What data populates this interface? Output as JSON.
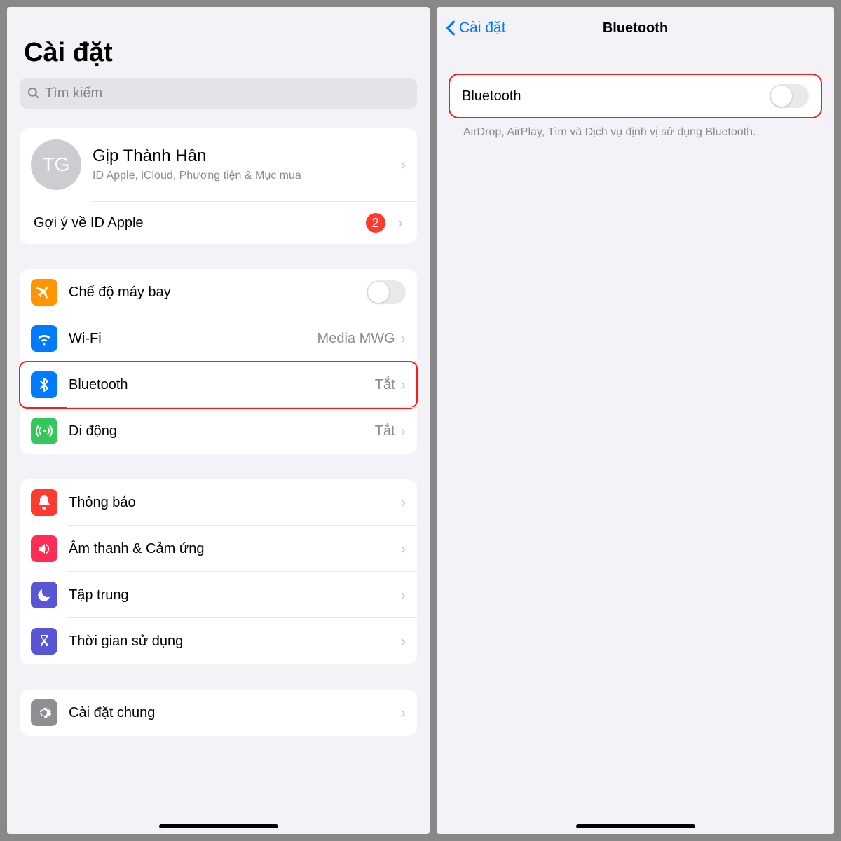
{
  "left": {
    "title": "Cài đặt",
    "search_placeholder": "Tìm kiếm",
    "profile": {
      "initials": "TG",
      "name": "Gịp Thành Hân",
      "subtitle": "ID Apple, iCloud, Phương tiện & Mục mua"
    },
    "suggestion": {
      "label": "Gợi ý về ID Apple",
      "badge": "2"
    },
    "group1": {
      "airplane": {
        "label": "Chế độ máy bay"
      },
      "wifi": {
        "label": "Wi-Fi",
        "value": "Media MWG"
      },
      "bluetooth": {
        "label": "Bluetooth",
        "value": "Tắt"
      },
      "cellular": {
        "label": "Di động",
        "value": "Tắt"
      }
    },
    "group2": {
      "notifications": {
        "label": "Thông báo"
      },
      "sounds": {
        "label": "Âm thanh & Cảm ứng"
      },
      "focus": {
        "label": "Tập trung"
      },
      "screentime": {
        "label": "Thời gian sử dụng"
      }
    },
    "group3": {
      "general": {
        "label": "Cài đặt chung"
      }
    }
  },
  "right": {
    "back_label": "Cài đặt",
    "title": "Bluetooth",
    "toggle_label": "Bluetooth",
    "note": "AirDrop, AirPlay, Tìm và Dịch vụ định vị sử dụng Bluetooth."
  }
}
